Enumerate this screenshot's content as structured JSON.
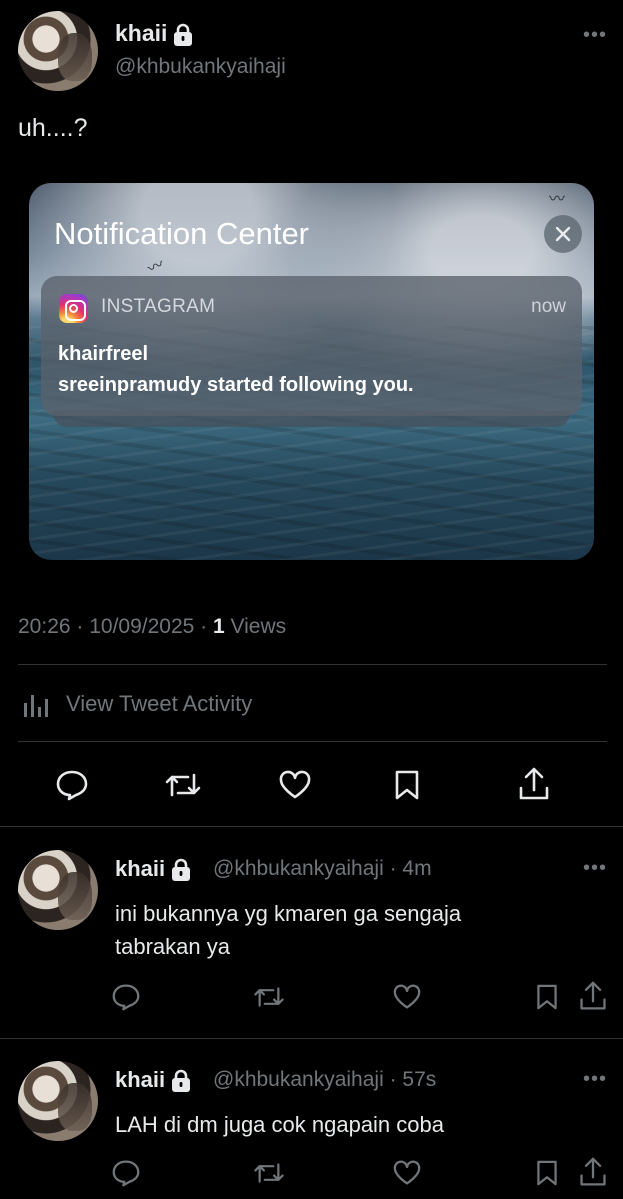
{
  "main_tweet": {
    "author_name": "khaii",
    "author_handle": "@khbukankyaihaji",
    "text": "uh....?",
    "timestamp": "20:26 · 10/09/2025 · ",
    "views_count": "1",
    "views_label": " Views",
    "activity_label": "View Tweet Activity"
  },
  "notification_card": {
    "title": "Notification Center",
    "app_name": "INSTAGRAM",
    "time": "now",
    "notif_title": "khairfreel",
    "notif_body": "sreeinpramudy started following you."
  },
  "replies": [
    {
      "author_name": "khaii",
      "author_handle": "@khbukankyaihaji · 4m",
      "text_line1": "ini bukannya yg kmaren ga sengaja",
      "text_line2": "tabrakan ya"
    },
    {
      "author_name": "khaii",
      "author_handle": "@khbukankyaihaji · 57s",
      "text_line1": "LAH di dm juga cok ngapain coba"
    }
  ],
  "more_glyph": "•••",
  "colors": {
    "background": "#000000",
    "text": "#e7e9ea",
    "muted": "#71767b",
    "divider": "#2f3336"
  }
}
